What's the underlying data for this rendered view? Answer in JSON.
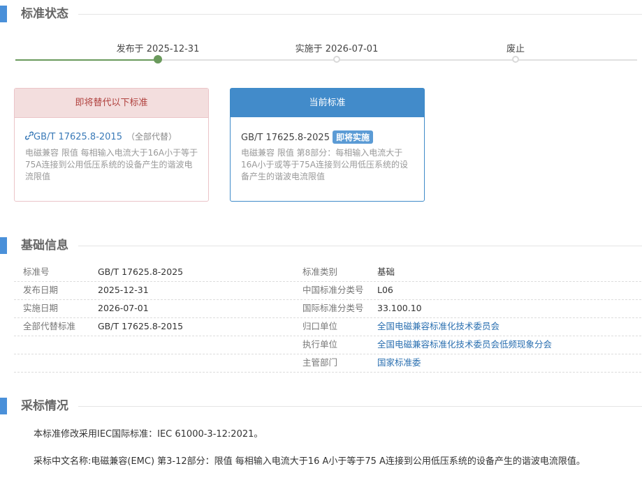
{
  "sections": {
    "status": "标准状态",
    "basic": "基础信息",
    "adoption": "采标情况"
  },
  "timeline": {
    "published": "发布于 2025-12-31",
    "implemented": "实施于 2026-07-01",
    "abolished": "废止",
    "colors": {
      "done": "#6a9a5c",
      "pending": "#e0e0e0"
    }
  },
  "replaced_card": {
    "header": "即将替代以下标准",
    "link_icon": "link-icon",
    "code": "GB/T 17625.8-2015",
    "note": "（全部代替）",
    "description": "电磁兼容 限值 每相输入电流大于16A小于等于75A连接到公用低压系统的设备产生的谐波电流限值"
  },
  "current_card": {
    "header": "当前标准",
    "code": "GB/T 17625.8-2025",
    "badge": "即将实施",
    "description": "电磁兼容 限值 第8部分：每相输入电流大于16A小于或等于75A连接到公用低压系统的设备产生的谐波电流限值"
  },
  "info": {
    "left": [
      {
        "label": "标准号",
        "value": "GB/T 17625.8-2025"
      },
      {
        "label": "发布日期",
        "value": "2025-12-31"
      },
      {
        "label": "实施日期",
        "value": "2026-07-01"
      },
      {
        "label": "全部代替标准",
        "value": "GB/T 17625.8-2015"
      }
    ],
    "right": [
      {
        "label": "标准类别",
        "value": "基础"
      },
      {
        "label": "中国标准分类号",
        "value": "L06"
      },
      {
        "label": "国际标准分类号",
        "value": "33.100.10"
      },
      {
        "label": "归口单位",
        "value": "全国电磁兼容标准化技术委员会"
      },
      {
        "label": "执行单位",
        "value": "全国电磁兼容标准化技术委员会低频现象分会"
      },
      {
        "label": "主管部门",
        "value": "国家标准委"
      }
    ]
  },
  "adoption": {
    "line1": "本标准修改采用IEC国际标准：IEC 61000-3-12:2021。",
    "line2": "采标中文名称:电磁兼容(EMC) 第3-12部分：限值 每相输入电流大于16 A小于等于75 A连接到公用低压系统的设备产生的谐波电流限值。"
  }
}
